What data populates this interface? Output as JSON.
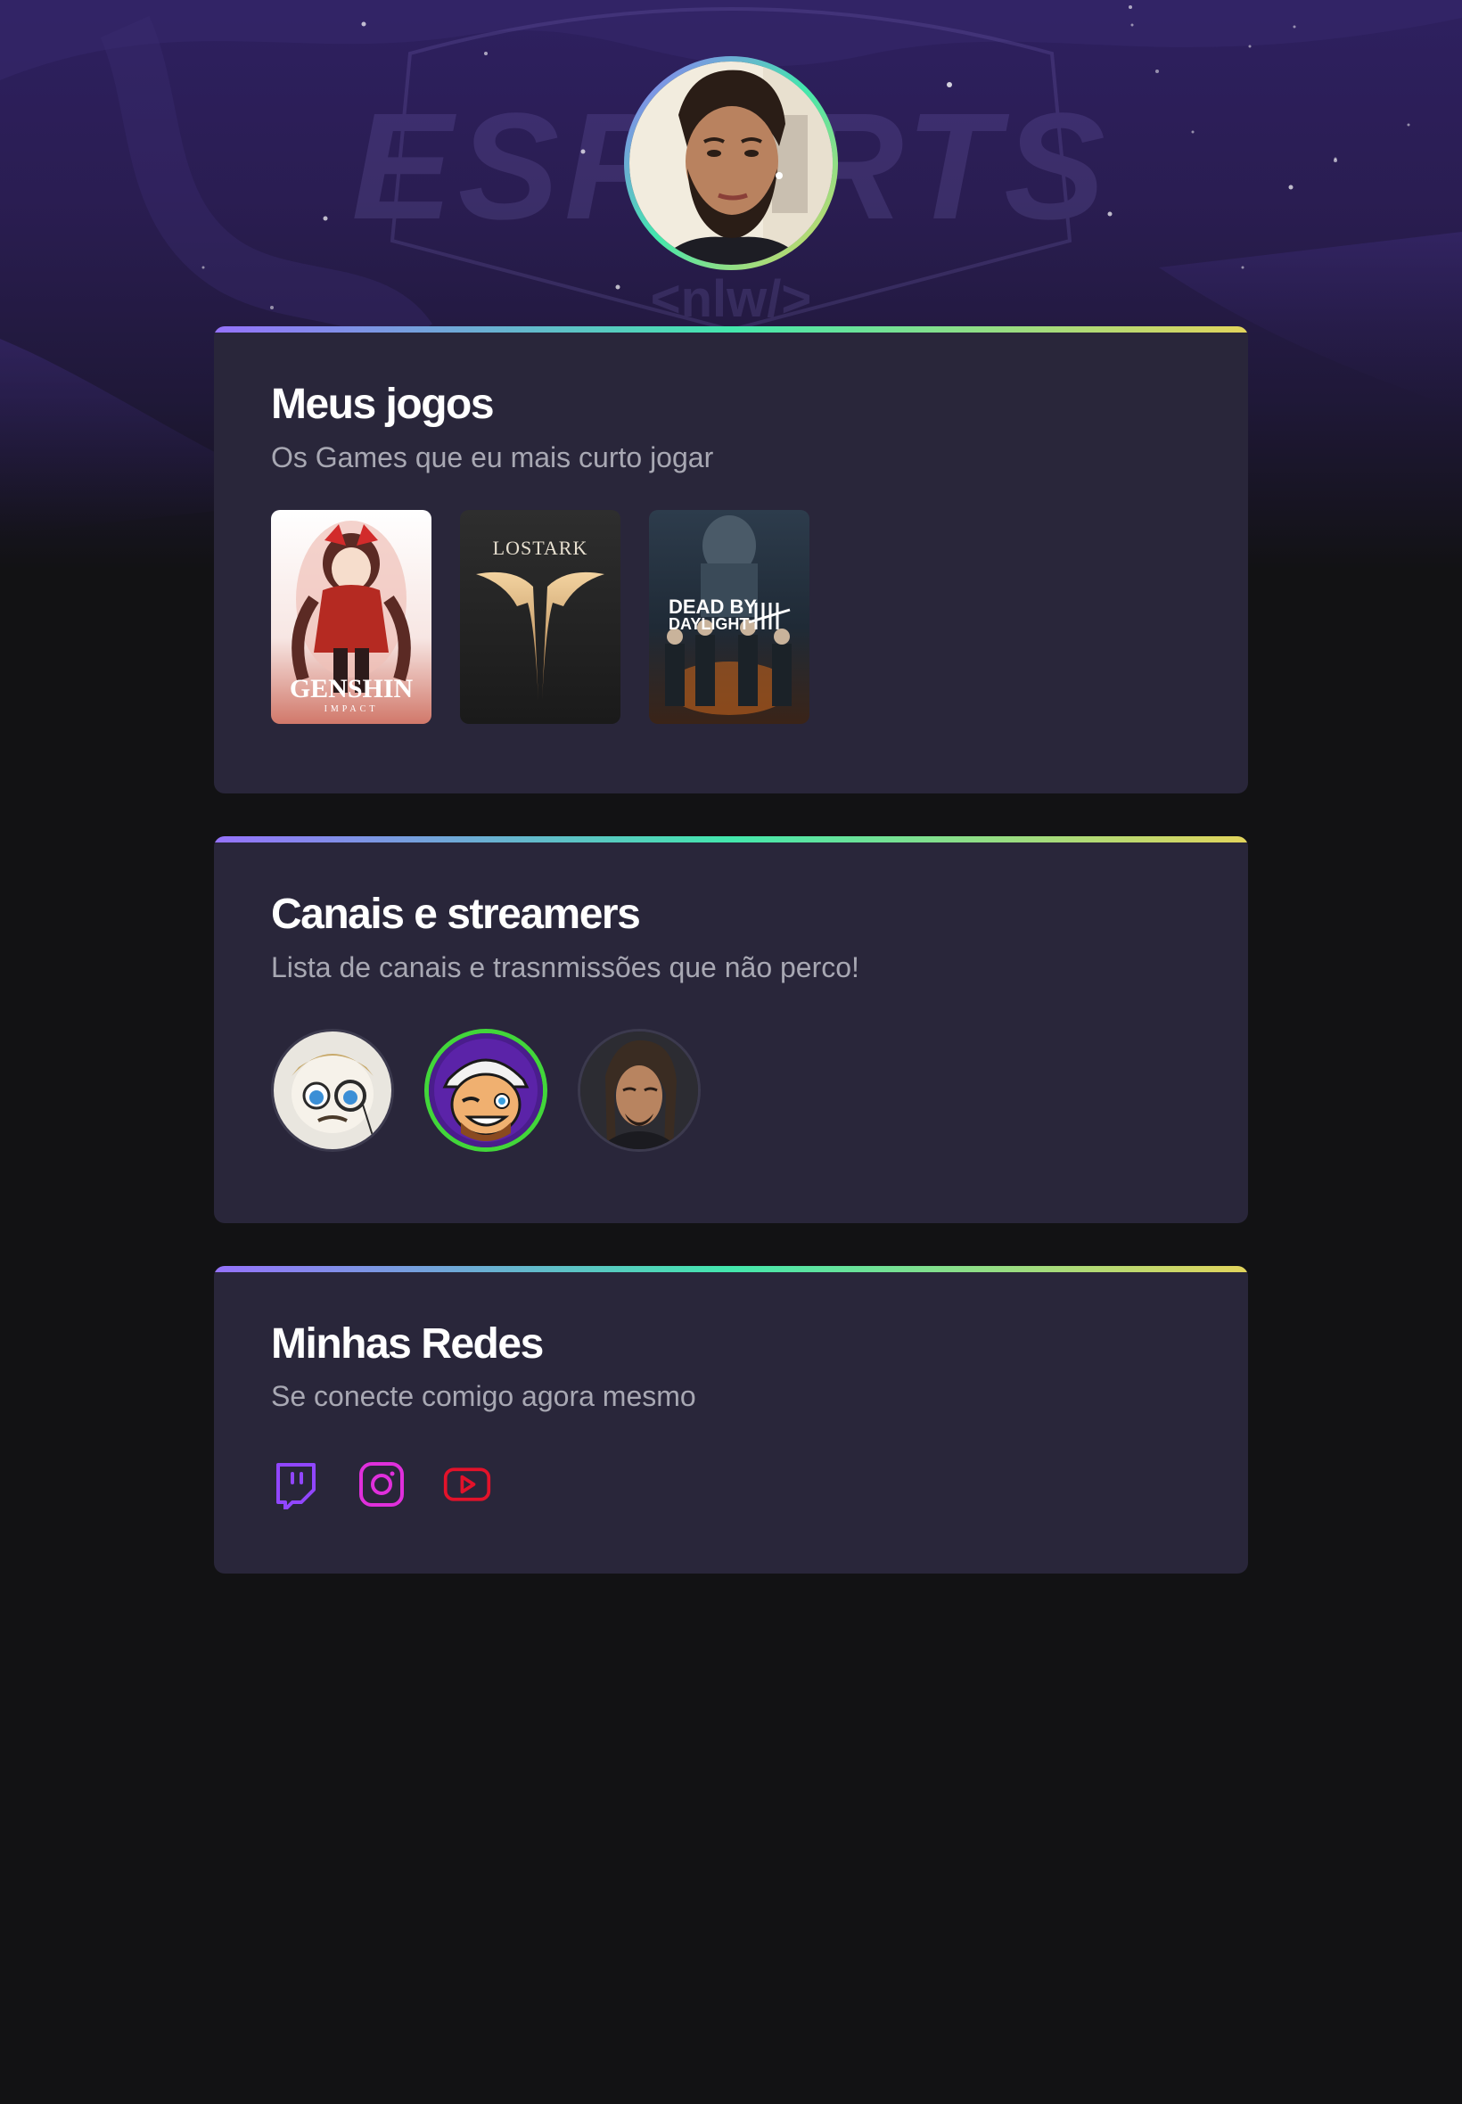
{
  "profile": {
    "avatar_icon": "profile-photo"
  },
  "background": {
    "watermark_text": "ESPORTS",
    "watermark_sub": "<nlw/>"
  },
  "sections": {
    "games": {
      "title": "Meus jogos",
      "subtitle": "Os Games que eu mais curto jogar",
      "items": [
        {
          "name": "Genshin Impact",
          "logo": "GENSHIN",
          "logo_sub": "IMPACT"
        },
        {
          "name": "Lost Ark",
          "logo": "LOSTARK"
        },
        {
          "name": "Dead by Daylight",
          "logo": "DEAD BY",
          "logo_sub": "DAYLIGHT"
        }
      ]
    },
    "streamers": {
      "title": "Canais e streamers",
      "subtitle": "Lista de canais e trasnmissões que não perco!",
      "items": [
        {
          "avatar_icon": "streamer-avatar-monocle"
        },
        {
          "avatar_icon": "streamer-avatar-cap"
        },
        {
          "avatar_icon": "streamer-avatar-photo"
        }
      ]
    },
    "socials": {
      "title": "Minhas Redes",
      "subtitle": "Se conecte comigo agora mesmo",
      "items": [
        {
          "icon": "twitch-icon",
          "color": "#9146ff"
        },
        {
          "icon": "instagram-icon",
          "color": "#e02fdc"
        },
        {
          "icon": "youtube-icon",
          "color": "#e3122a"
        }
      ]
    }
  },
  "colors": {
    "background": "#121214",
    "card": "#29263a",
    "gradient": [
      "#9572fc",
      "#43e7ad",
      "#e2d45c"
    ],
    "title": "#ffffff",
    "subtitle": "#a8a8b3"
  }
}
